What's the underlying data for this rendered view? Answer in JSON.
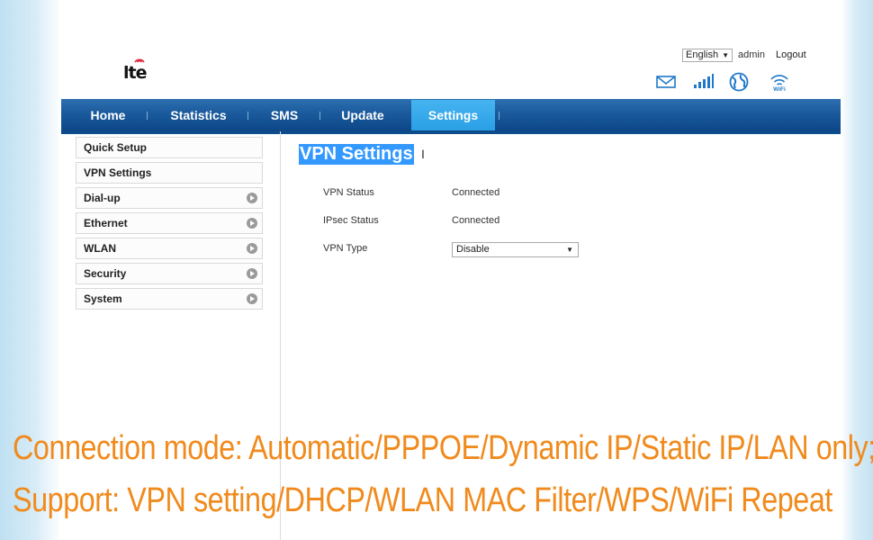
{
  "header": {
    "logo_text": "lte",
    "language": "English",
    "user": "admin",
    "logout_label": "Logout",
    "status_icons": [
      "mail-icon",
      "signal-icon",
      "globe-icon",
      "wifi-icon"
    ]
  },
  "nav": {
    "items": [
      {
        "label": "Home",
        "active": false
      },
      {
        "label": "Statistics",
        "active": false
      },
      {
        "label": "SMS",
        "active": false
      },
      {
        "label": "Update",
        "active": false
      },
      {
        "label": "Settings",
        "active": true
      }
    ]
  },
  "sidebar": {
    "items": [
      {
        "label": "Quick Setup",
        "expandable": false
      },
      {
        "label": "VPN Settings",
        "expandable": false
      },
      {
        "label": "Dial-up",
        "expandable": true
      },
      {
        "label": "Ethernet",
        "expandable": true
      },
      {
        "label": "WLAN",
        "expandable": true
      },
      {
        "label": "Security",
        "expandable": true
      },
      {
        "label": "System",
        "expandable": true
      }
    ]
  },
  "main": {
    "title": "VPN Settings",
    "fields": [
      {
        "label": "VPN Status",
        "value": "Connected"
      },
      {
        "label": "IPsec Status",
        "value": "Connected"
      }
    ],
    "vpn_type": {
      "label": "VPN Type",
      "selected": "Disable"
    }
  },
  "promo": {
    "line1": "Connection mode: Automatic/PPPOE/Dynamic IP/Static IP/LAN only;",
    "line2": "Support: VPN setting/DHCP/WLAN MAC Filter/WPS/WiFi Repeat"
  },
  "colors": {
    "nav_bg": "#1a5a9c",
    "nav_active": "#2aa0e6",
    "icon_blue": "#1f78c8",
    "promo_text": "#f08a1c",
    "title_highlight": "#3399ff"
  }
}
